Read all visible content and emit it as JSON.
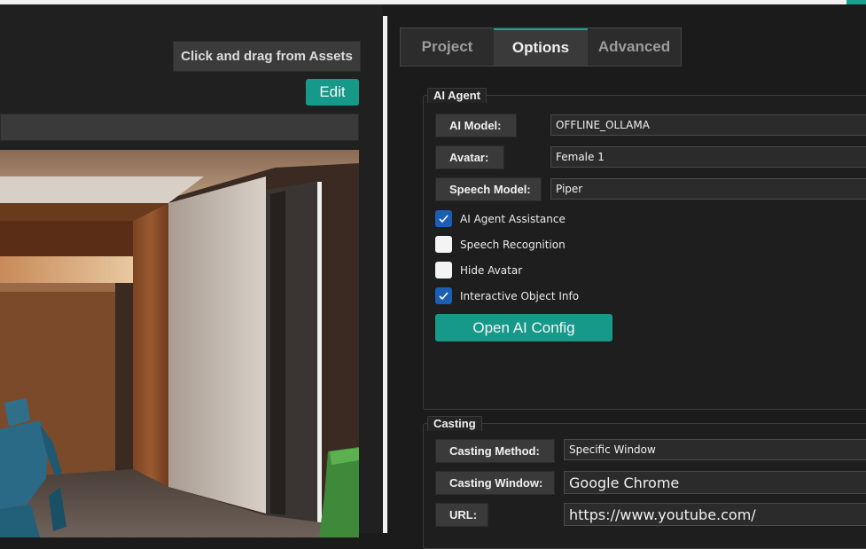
{
  "left": {
    "hint": "Click and drag from Assets",
    "edit_label": "Edit"
  },
  "tabs": [
    {
      "label": "Project"
    },
    {
      "label": "Options"
    },
    {
      "label": "Advanced"
    }
  ],
  "active_tab": "Options",
  "ai_agent": {
    "title": "AI Agent",
    "model_label": "AI Model:",
    "model_value": "OFFLINE_OLLAMA",
    "avatar_label": "Avatar:",
    "avatar_value": "Female 1",
    "speech_label": "Speech Model:",
    "speech_value": "Piper",
    "checks": [
      {
        "label": "AI Agent Assistance",
        "checked": true
      },
      {
        "label": "Speech Recognition",
        "checked": false
      },
      {
        "label": "Hide Avatar",
        "checked": false
      },
      {
        "label": "Interactive Object Info",
        "checked": true
      }
    ],
    "open_config_label": "Open AI Config"
  },
  "casting": {
    "title": "Casting",
    "method_label": "Casting Method:",
    "method_value": "Specific Window",
    "window_label": "Casting Window:",
    "window_value": "Google Chrome",
    "url_label": "URL:",
    "url_value": "https://www.youtube.com/"
  },
  "colors": {
    "accent": "#17998a",
    "checkbox_on": "#1b5eb5"
  }
}
